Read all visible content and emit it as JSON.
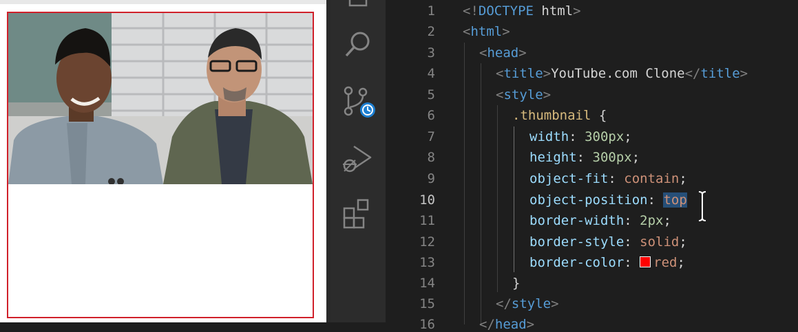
{
  "preview": {
    "thumbnail_alt": "Two men seated side by side, smiling",
    "border_color": "#d0202a"
  },
  "activity_bar": {
    "icons": [
      "explorer-icon",
      "search-icon",
      "source-control-icon",
      "run-debug-icon",
      "extensions-icon"
    ]
  },
  "editor": {
    "active_line": 10,
    "line_numbers": [
      "1",
      "2",
      "3",
      "4",
      "5",
      "6",
      "7",
      "8",
      "9",
      "10",
      "11",
      "12",
      "13",
      "14",
      "15",
      "16"
    ],
    "lines": {
      "l1": {
        "open": "<!",
        "doctype": "DOCTYPE",
        "rest": " html",
        "close": ">"
      },
      "l2": {
        "open": "<",
        "tag": "html",
        "close": ">"
      },
      "l3": {
        "open": "<",
        "tag": "head",
        "close": ">"
      },
      "l4": {
        "open": "<",
        "tag": "title",
        "close": ">",
        "text": "YouTube.com Clone",
        "end_open": "</",
        "end_tag": "title",
        "end_close": ">"
      },
      "l5": {
        "open": "<",
        "tag": "style",
        "close": ">"
      },
      "l6": {
        "selector": ".thumbnail",
        "brace": " {"
      },
      "l7": {
        "prop": "width",
        "colon": ": ",
        "value": "300px",
        "semi": ";"
      },
      "l8": {
        "prop": "height",
        "colon": ": ",
        "value": "300px",
        "semi": ";"
      },
      "l9": {
        "prop": "object-fit",
        "colon": ": ",
        "value": "contain",
        "semi": ";"
      },
      "l10": {
        "prop": "object-position",
        "colon": ": ",
        "value": "top",
        "semi": ""
      },
      "l11": {
        "prop": "border-width",
        "colon": ": ",
        "value": "2px",
        "semi": ";"
      },
      "l12": {
        "prop": "border-style",
        "colon": ": ",
        "value": "solid",
        "semi": ";"
      },
      "l13": {
        "prop": "border-color",
        "colon": ": ",
        "value": "red",
        "semi": ";",
        "swatch": "#ff0000"
      },
      "l14": {
        "brace": "}"
      },
      "l15": {
        "open": "</",
        "tag": "style",
        "close": ">"
      },
      "l16": {
        "open": "</",
        "tag": "head",
        "close": ">"
      }
    }
  }
}
